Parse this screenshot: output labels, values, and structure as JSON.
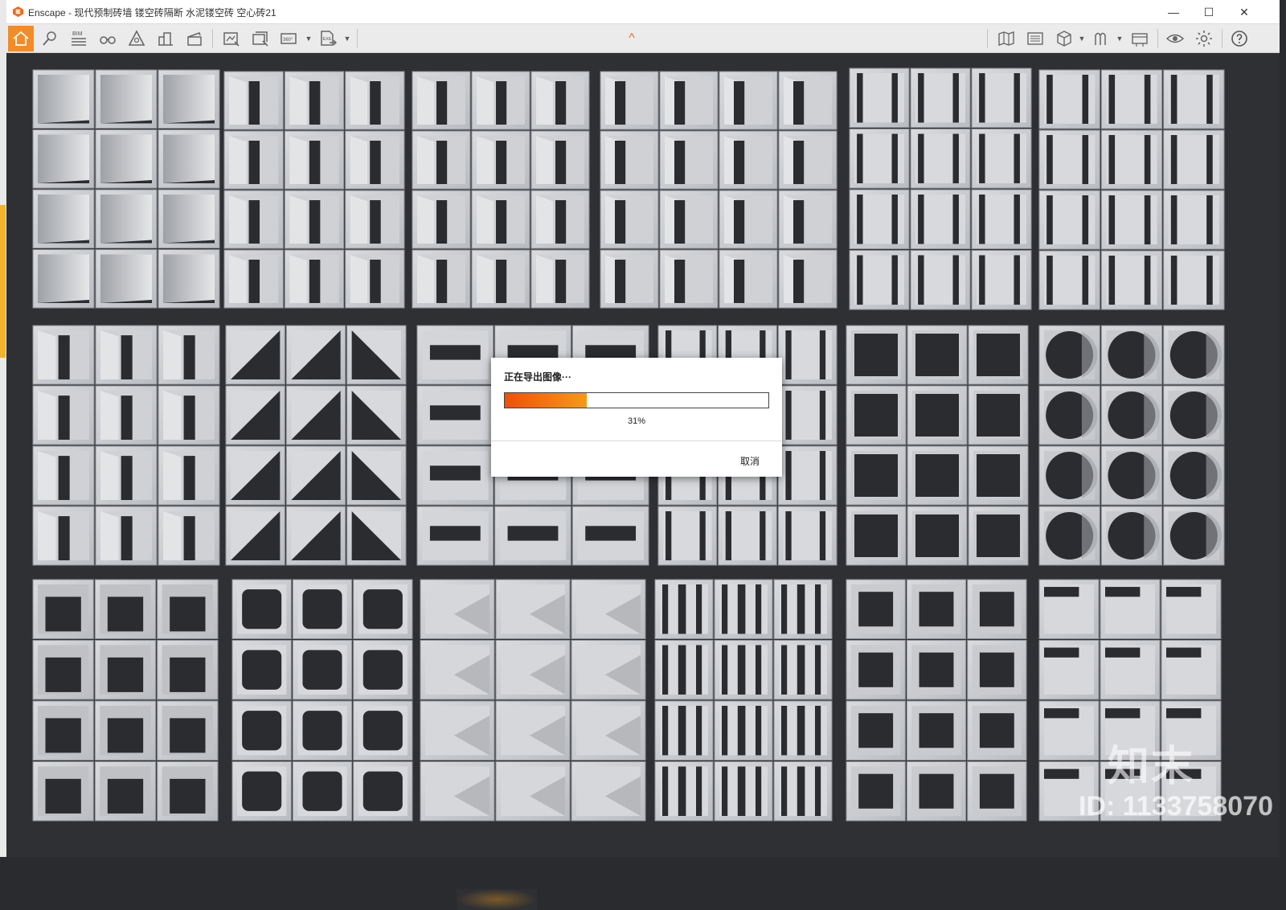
{
  "window": {
    "title": "Enscape - 现代预制砖墙 镂空砖隔断 水泥镂空砖 空心砖21",
    "minimize_glyph": "—",
    "maximize_glyph": "☐",
    "close_glyph": "✕"
  },
  "toolbar": {
    "left_icons": [
      "home-icon",
      "bim-info-icon",
      "bim-icon",
      "binoculars-icon",
      "alert-icon",
      "buildings-icon",
      "clapperboard-icon",
      "screenshot-icon",
      "batch-render-icon",
      "panorama-360-icon",
      "exe-export-icon"
    ],
    "right_icons": [
      "map-icon",
      "atlas-icon",
      "cube-icon",
      "asset-library-icon",
      "video-icon",
      "eye-icon",
      "settings-icon",
      "help-icon"
    ],
    "bim_label": "BIM",
    "pano_label": "360°",
    "exe_label": "EXE",
    "collapse_glyph": "^"
  },
  "colors": {
    "accent": "#f28c28",
    "progress_start": "#f0500a",
    "progress_end": "#f59a1a",
    "viewport_bg": "#2f3033"
  },
  "export_dialog": {
    "title": "正在导出图像···",
    "progress": 0.31,
    "progress_text": "31%",
    "cancel_label": "取消"
  },
  "watermark": {
    "brand": "知末",
    "id": "ID: 1133758070"
  }
}
